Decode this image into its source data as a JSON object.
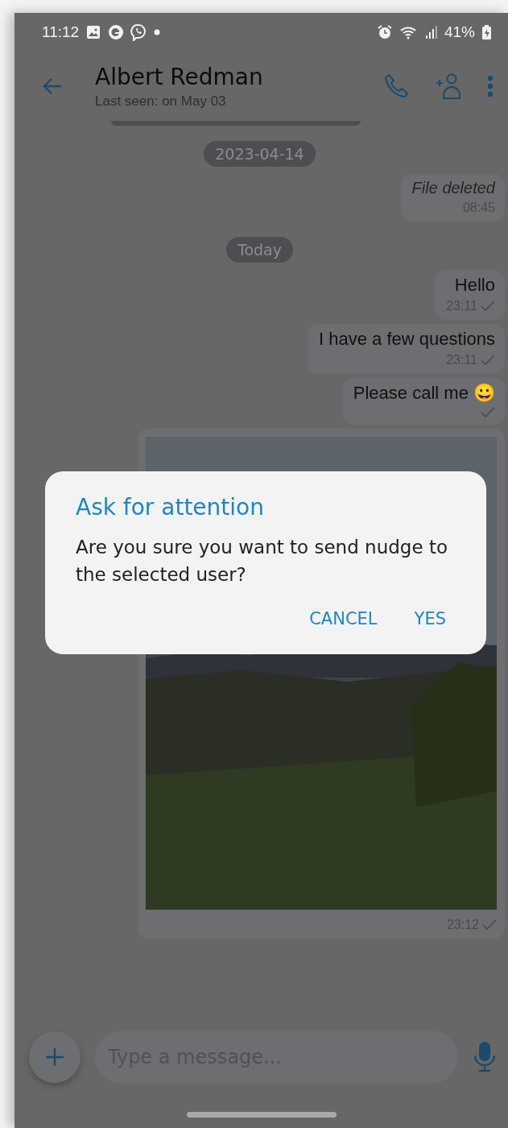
{
  "status_bar": {
    "time": "11:12",
    "battery": "41%"
  },
  "header": {
    "title": "Albert Redman",
    "subtitle": "Last seen: on May 03"
  },
  "messages": [
    {
      "kind": "date",
      "text": "2023-04-14"
    },
    {
      "kind": "deleted",
      "text": "File deleted",
      "time": "08:45"
    },
    {
      "kind": "date",
      "text": "Today"
    },
    {
      "kind": "text",
      "text": "Hello",
      "time": "23:11",
      "delivered": true
    },
    {
      "kind": "text",
      "text": "I have a few questions",
      "time": "23:11",
      "delivered": true
    },
    {
      "kind": "text",
      "text": "Please call me 😀",
      "delivered": true
    },
    {
      "kind": "image",
      "time": "23:12",
      "delivered": true
    }
  ],
  "composer": {
    "placeholder": "Type a message..."
  },
  "dialog": {
    "title": "Ask for attention",
    "message": "Are you sure you want to send nudge to the selected user?",
    "buttons": [
      "CANCEL",
      "YES"
    ]
  }
}
